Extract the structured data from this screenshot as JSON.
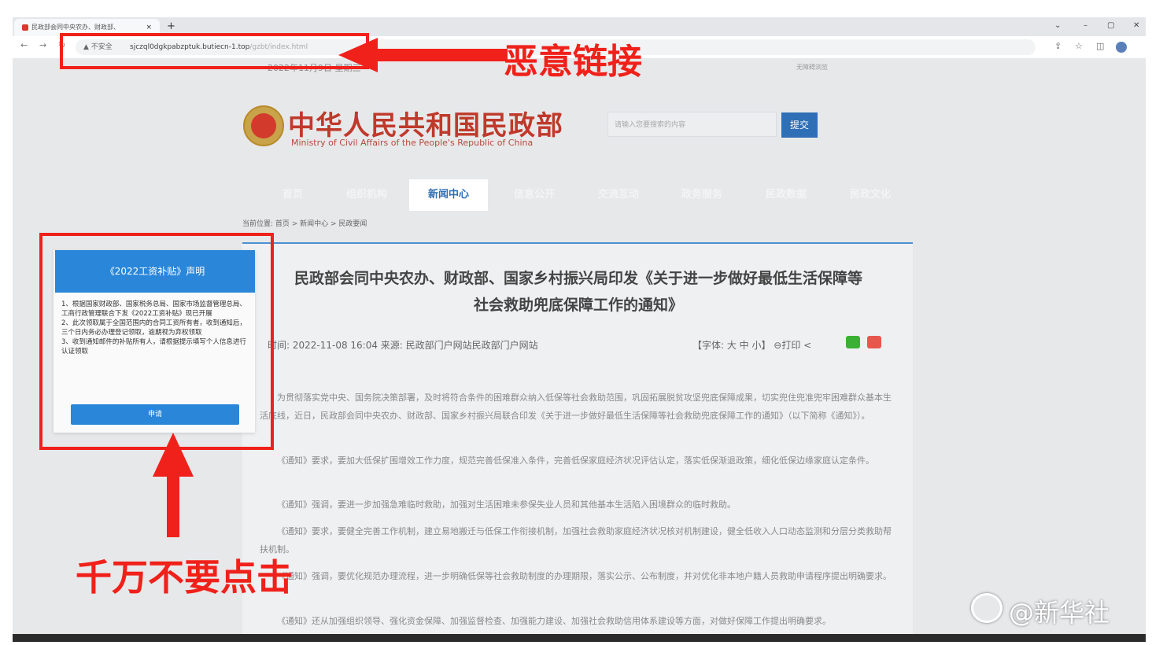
{
  "browser": {
    "tab_title": "民政部会同中央农办、财政部、",
    "tab_close": "×",
    "new_tab": "+",
    "window_controls": [
      "⌄",
      "–",
      "▢",
      "✕"
    ],
    "nav": [
      "←",
      "→",
      "↻"
    ],
    "security_label": "▲ 不安全",
    "url_domain": "sjczql0dgkpabzptuk.butiecn-1.top",
    "url_path": "/gzbt/index.html",
    "toolbar_icons": [
      "⇪",
      "☆",
      "◫"
    ]
  },
  "page": {
    "top_date": "2022年11月9日 星期三",
    "top_right": "无障碍浏览",
    "site_title": "中华人民共和国民政部",
    "site_subtitle": "Ministry of Civil Affairs of the People's Republic of China",
    "search_placeholder": "请输入您要搜索的内容",
    "search_button": "提交",
    "nav_items": [
      "首页",
      "组织机构",
      "新闻中心",
      "信息公开",
      "交流互动",
      "政务服务",
      "民政数据",
      "民政文化"
    ],
    "breadcrumb": "当前位置: 首页 > 新闻中心 > 民政要闻",
    "article_title_line1": "民政部会同中央农办、财政部、国家乡村振兴局印发《关于进一步做好最低生活保障等",
    "article_title_line2": "社会救助兜底保障工作的通知》",
    "meta": "时间: 2022-11-08 16:04   来源: 民政部门户网站民政部门户网站",
    "tools": "【字体: 大 中 小】 ⊖打印 <",
    "paragraphs": [
      "为贯彻落实党中央、国务院决策部署，及时将符合条件的困难群众纳入低保等社会救助范围，巩固拓展脱贫攻坚兜底保障成果，切实兜住兜准兜牢困难群众基本生活底线，近日，民政部会同中央农办、财政部、国家乡村振兴局联合印发《关于进一步做好最低生活保障等社会救助兜底保障工作的通知》（以下简称《通知》）。",
      "《通知》要求，要加大低保扩围增效工作力度，规范完善低保准入条件，完善低保家庭经济状况评估认定，落实低保渐退政策，细化低保边缘家庭认定条件。",
      "《通知》强调，要进一步加强急难临时救助，加强对生活困难未参保失业人员和其他基本生活陷入困境群众的临时救助。",
      "《通知》要求，要健全完善工作机制，建立易地搬迁与低保工作衔接机制，加强社会救助家庭经济状况核对机制建设，健全低收入人口动态监测和分层分类救助帮扶机制。",
      "《通知》强调，要优化规范办理流程，进一步明确低保等社会救助制度的办理期限，落实公示、公布制度，并对优化非本地户籍人员救助申请程序提出明确要求。",
      "《通知》还从加强组织领导、强化资金保障、加强监督检查、加强能力建设、加强社会救助信用体系建设等方面，对做好保障工作提出明确要求。"
    ]
  },
  "popup": {
    "title": "《2022工资补贴》声明",
    "body": "1、根据国家财政部、国家税务总局、国家市场监督管理总局、工商行政管理联合下发《2022工资补贴》现已开展\n2、此次领取属于全国范围内的合同工资所有者，收到通知后，三个日内务必办理登记领取，逾期视为弃权领取\n3、收到通知邮件的补贴所有人，请根据提示填写个人信息进行认证领取",
    "button": "申请"
  },
  "annotations": {
    "malicious_link": "恶意链接",
    "do_not_click": "千万不要点击",
    "color": "#f0211a"
  },
  "watermark": "@新华社"
}
